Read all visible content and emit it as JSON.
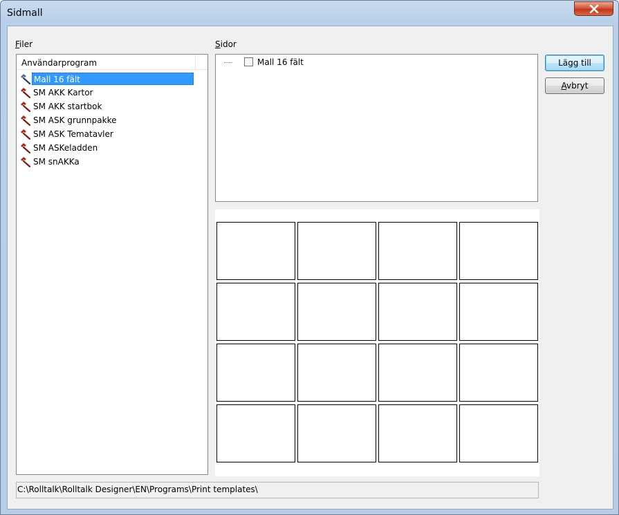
{
  "window": {
    "title": "Sidmall"
  },
  "files": {
    "label_mnemonic": "F",
    "label_rest": "iler",
    "column_header": "Användarprogram",
    "items": [
      {
        "label": "Mall 16 fält",
        "selected": true,
        "icon": "hammer-icon-blue"
      },
      {
        "label": "SM AKK Kartor",
        "selected": false,
        "icon": "hammer-icon"
      },
      {
        "label": "SM AKK startbok",
        "selected": false,
        "icon": "hammer-icon"
      },
      {
        "label": "SM ASK grunnpakke",
        "selected": false,
        "icon": "hammer-icon"
      },
      {
        "label": "SM ASK Tematavler",
        "selected": false,
        "icon": "hammer-icon"
      },
      {
        "label": "SM ASKeladden",
        "selected": false,
        "icon": "hammer-icon"
      },
      {
        "label": "SM snAKKa",
        "selected": false,
        "icon": "hammer-icon"
      }
    ]
  },
  "pages": {
    "label_mnemonic": "S",
    "label_rest": "idor",
    "tree_items": [
      {
        "label": "Mall 16 fält",
        "checked": false
      }
    ]
  },
  "buttons": {
    "add_label": "Lägg till",
    "cancel_mnemonic": "A",
    "cancel_rest": "vbryt"
  },
  "preview": {
    "rows": 4,
    "columns": 4
  },
  "path": "C:\\Rolltalk\\Rolltalk Designer\\EN\\Programs\\Print templates\\",
  "colors": {
    "selection": "#3399ff",
    "close_button": "#c2361d"
  }
}
